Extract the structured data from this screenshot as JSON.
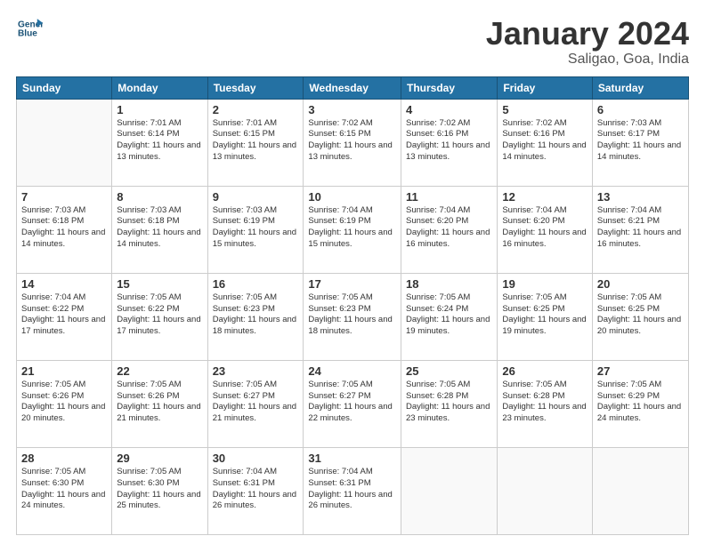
{
  "header": {
    "logo_line1": "General",
    "logo_line2": "Blue",
    "month_title": "January 2024",
    "location": "Saligao, Goa, India"
  },
  "weekdays": [
    "Sunday",
    "Monday",
    "Tuesday",
    "Wednesday",
    "Thursday",
    "Friday",
    "Saturday"
  ],
  "weeks": [
    [
      {
        "day": "",
        "sunrise": "",
        "sunset": "",
        "daylight": ""
      },
      {
        "day": "1",
        "sunrise": "Sunrise: 7:01 AM",
        "sunset": "Sunset: 6:14 PM",
        "daylight": "Daylight: 11 hours and 13 minutes."
      },
      {
        "day": "2",
        "sunrise": "Sunrise: 7:01 AM",
        "sunset": "Sunset: 6:15 PM",
        "daylight": "Daylight: 11 hours and 13 minutes."
      },
      {
        "day": "3",
        "sunrise": "Sunrise: 7:02 AM",
        "sunset": "Sunset: 6:15 PM",
        "daylight": "Daylight: 11 hours and 13 minutes."
      },
      {
        "day": "4",
        "sunrise": "Sunrise: 7:02 AM",
        "sunset": "Sunset: 6:16 PM",
        "daylight": "Daylight: 11 hours and 13 minutes."
      },
      {
        "day": "5",
        "sunrise": "Sunrise: 7:02 AM",
        "sunset": "Sunset: 6:16 PM",
        "daylight": "Daylight: 11 hours and 14 minutes."
      },
      {
        "day": "6",
        "sunrise": "Sunrise: 7:03 AM",
        "sunset": "Sunset: 6:17 PM",
        "daylight": "Daylight: 11 hours and 14 minutes."
      }
    ],
    [
      {
        "day": "7",
        "sunrise": "Sunrise: 7:03 AM",
        "sunset": "Sunset: 6:18 PM",
        "daylight": "Daylight: 11 hours and 14 minutes."
      },
      {
        "day": "8",
        "sunrise": "Sunrise: 7:03 AM",
        "sunset": "Sunset: 6:18 PM",
        "daylight": "Daylight: 11 hours and 14 minutes."
      },
      {
        "day": "9",
        "sunrise": "Sunrise: 7:03 AM",
        "sunset": "Sunset: 6:19 PM",
        "daylight": "Daylight: 11 hours and 15 minutes."
      },
      {
        "day": "10",
        "sunrise": "Sunrise: 7:04 AM",
        "sunset": "Sunset: 6:19 PM",
        "daylight": "Daylight: 11 hours and 15 minutes."
      },
      {
        "day": "11",
        "sunrise": "Sunrise: 7:04 AM",
        "sunset": "Sunset: 6:20 PM",
        "daylight": "Daylight: 11 hours and 16 minutes."
      },
      {
        "day": "12",
        "sunrise": "Sunrise: 7:04 AM",
        "sunset": "Sunset: 6:20 PM",
        "daylight": "Daylight: 11 hours and 16 minutes."
      },
      {
        "day": "13",
        "sunrise": "Sunrise: 7:04 AM",
        "sunset": "Sunset: 6:21 PM",
        "daylight": "Daylight: 11 hours and 16 minutes."
      }
    ],
    [
      {
        "day": "14",
        "sunrise": "Sunrise: 7:04 AM",
        "sunset": "Sunset: 6:22 PM",
        "daylight": "Daylight: 11 hours and 17 minutes."
      },
      {
        "day": "15",
        "sunrise": "Sunrise: 7:05 AM",
        "sunset": "Sunset: 6:22 PM",
        "daylight": "Daylight: 11 hours and 17 minutes."
      },
      {
        "day": "16",
        "sunrise": "Sunrise: 7:05 AM",
        "sunset": "Sunset: 6:23 PM",
        "daylight": "Daylight: 11 hours and 18 minutes."
      },
      {
        "day": "17",
        "sunrise": "Sunrise: 7:05 AM",
        "sunset": "Sunset: 6:23 PM",
        "daylight": "Daylight: 11 hours and 18 minutes."
      },
      {
        "day": "18",
        "sunrise": "Sunrise: 7:05 AM",
        "sunset": "Sunset: 6:24 PM",
        "daylight": "Daylight: 11 hours and 19 minutes."
      },
      {
        "day": "19",
        "sunrise": "Sunrise: 7:05 AM",
        "sunset": "Sunset: 6:25 PM",
        "daylight": "Daylight: 11 hours and 19 minutes."
      },
      {
        "day": "20",
        "sunrise": "Sunrise: 7:05 AM",
        "sunset": "Sunset: 6:25 PM",
        "daylight": "Daylight: 11 hours and 20 minutes."
      }
    ],
    [
      {
        "day": "21",
        "sunrise": "Sunrise: 7:05 AM",
        "sunset": "Sunset: 6:26 PM",
        "daylight": "Daylight: 11 hours and 20 minutes."
      },
      {
        "day": "22",
        "sunrise": "Sunrise: 7:05 AM",
        "sunset": "Sunset: 6:26 PM",
        "daylight": "Daylight: 11 hours and 21 minutes."
      },
      {
        "day": "23",
        "sunrise": "Sunrise: 7:05 AM",
        "sunset": "Sunset: 6:27 PM",
        "daylight": "Daylight: 11 hours and 21 minutes."
      },
      {
        "day": "24",
        "sunrise": "Sunrise: 7:05 AM",
        "sunset": "Sunset: 6:27 PM",
        "daylight": "Daylight: 11 hours and 22 minutes."
      },
      {
        "day": "25",
        "sunrise": "Sunrise: 7:05 AM",
        "sunset": "Sunset: 6:28 PM",
        "daylight": "Daylight: 11 hours and 23 minutes."
      },
      {
        "day": "26",
        "sunrise": "Sunrise: 7:05 AM",
        "sunset": "Sunset: 6:28 PM",
        "daylight": "Daylight: 11 hours and 23 minutes."
      },
      {
        "day": "27",
        "sunrise": "Sunrise: 7:05 AM",
        "sunset": "Sunset: 6:29 PM",
        "daylight": "Daylight: 11 hours and 24 minutes."
      }
    ],
    [
      {
        "day": "28",
        "sunrise": "Sunrise: 7:05 AM",
        "sunset": "Sunset: 6:30 PM",
        "daylight": "Daylight: 11 hours and 24 minutes."
      },
      {
        "day": "29",
        "sunrise": "Sunrise: 7:05 AM",
        "sunset": "Sunset: 6:30 PM",
        "daylight": "Daylight: 11 hours and 25 minutes."
      },
      {
        "day": "30",
        "sunrise": "Sunrise: 7:04 AM",
        "sunset": "Sunset: 6:31 PM",
        "daylight": "Daylight: 11 hours and 26 minutes."
      },
      {
        "day": "31",
        "sunrise": "Sunrise: 7:04 AM",
        "sunset": "Sunset: 6:31 PM",
        "daylight": "Daylight: 11 hours and 26 minutes."
      },
      {
        "day": "",
        "sunrise": "",
        "sunset": "",
        "daylight": ""
      },
      {
        "day": "",
        "sunrise": "",
        "sunset": "",
        "daylight": ""
      },
      {
        "day": "",
        "sunrise": "",
        "sunset": "",
        "daylight": ""
      }
    ]
  ]
}
